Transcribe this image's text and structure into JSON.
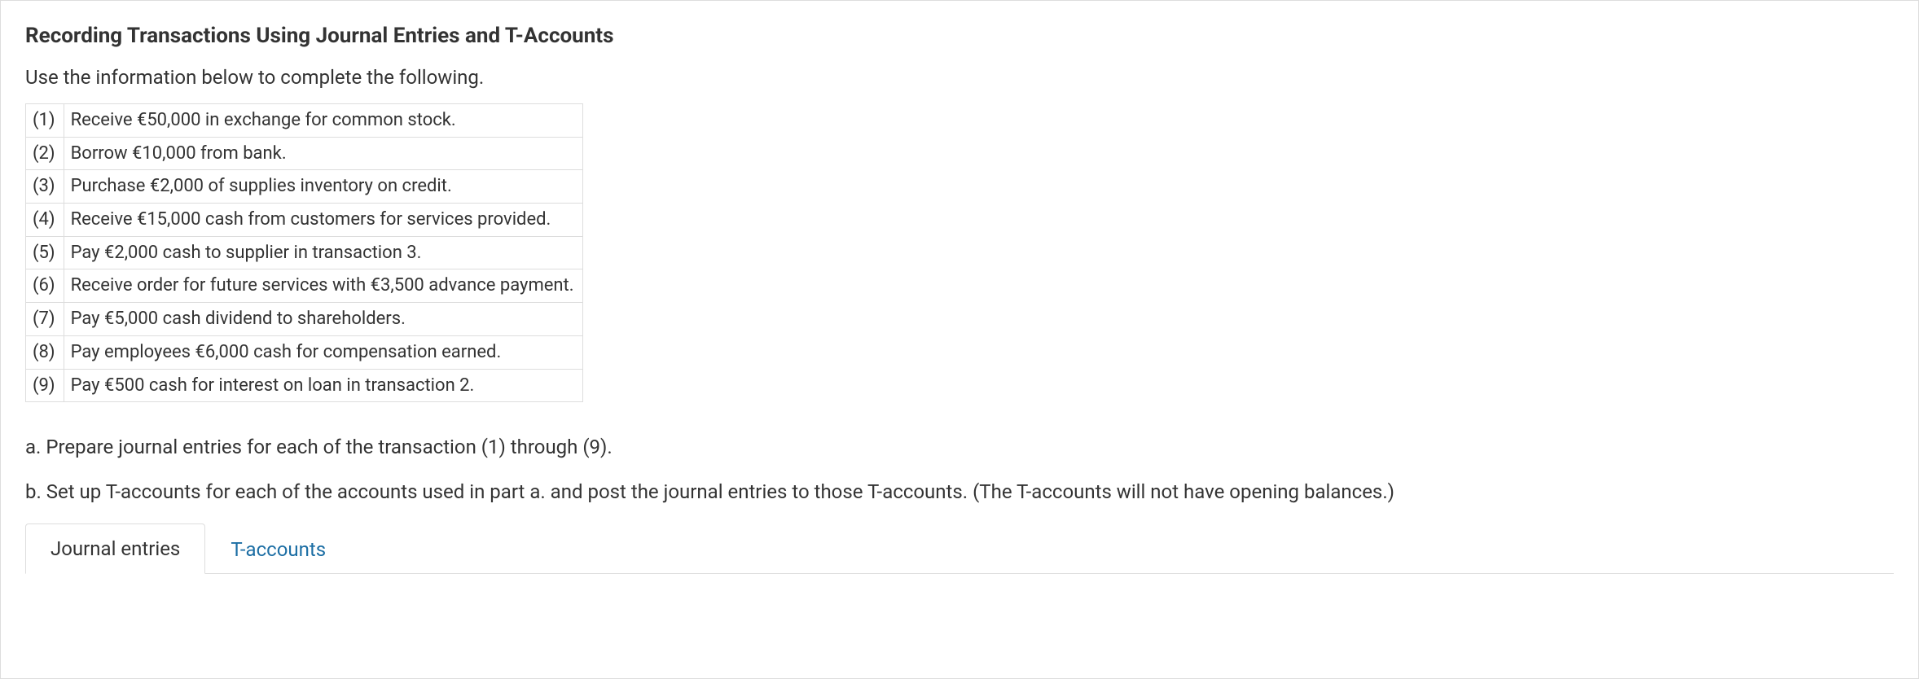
{
  "title": "Recording Transactions Using Journal Entries and T-Accounts",
  "intro": "Use the information below to complete the following.",
  "transactions": [
    {
      "num": "(1)",
      "desc": "Receive €50,000 in exchange for common stock."
    },
    {
      "num": "(2)",
      "desc": "Borrow €10,000 from bank."
    },
    {
      "num": "(3)",
      "desc": "Purchase €2,000 of supplies inventory on credit."
    },
    {
      "num": "(4)",
      "desc": "Receive €15,000 cash from customers for services provided."
    },
    {
      "num": "(5)",
      "desc": "Pay €2,000 cash to supplier in transaction 3."
    },
    {
      "num": "(6)",
      "desc": "Receive order for future services with €3,500 advance payment."
    },
    {
      "num": "(7)",
      "desc": "Pay €5,000 cash dividend to shareholders."
    },
    {
      "num": "(8)",
      "desc": "Pay employees €6,000 cash for compensation earned."
    },
    {
      "num": "(9)",
      "desc": "Pay €500 cash for interest on loan in transaction 2."
    }
  ],
  "instructions": {
    "a": "a. Prepare journal entries for each of the transaction (1) through (9).",
    "b": "b. Set up T-accounts for each of the accounts used in part a. and post the journal entries to those T-accounts. (The T-accounts will not have opening balances.)"
  },
  "tabs": {
    "journal": "Journal entries",
    "taccounts": "T-accounts"
  }
}
